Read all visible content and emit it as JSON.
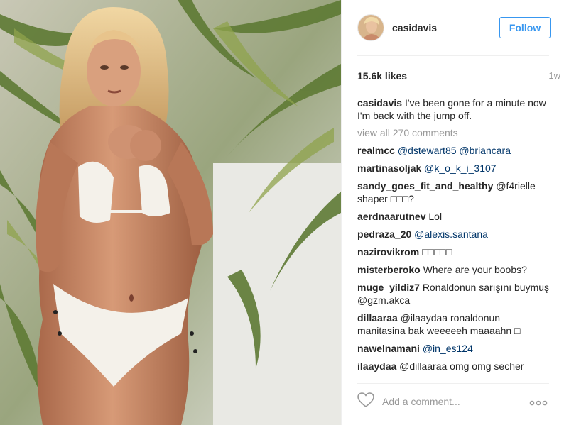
{
  "post": {
    "image_alt": "Woman in white crochet bikini in front of palm leaves"
  },
  "header": {
    "username": "casidavis",
    "follow_label": "Follow"
  },
  "stats": {
    "likes": "15.6k likes",
    "age": "1w"
  },
  "caption": {
    "username": "casidavis",
    "text": " I've been gone for a minute now I'm back with the jump off."
  },
  "view_all_label": "view all 270 comments",
  "comments": [
    {
      "user": "realmcc",
      "text": "@dstewart85 @briancara"
    },
    {
      "user": "martinasoljak",
      "text": "@k_o_k_i_3107"
    },
    {
      "user": "sandy_goes_fit_and_healthy",
      "text": "@f4rielle shaper □□□?"
    },
    {
      "user": "aerdnaarutnev",
      "text": "Lol"
    },
    {
      "user": "pedraza_20",
      "text": "@alexis.santana"
    },
    {
      "user": "nazirovikrom",
      "text": "□□□□□"
    },
    {
      "user": "misterberoko",
      "text": "Where are your boobs?"
    },
    {
      "user": "muge_yildiz7",
      "text": "Ronaldonun sarışını buymuş @gzm.akca"
    },
    {
      "user": "dillaaraa",
      "text": "@ilaaydaa ronaldonun manitasina bak weeeeeh maaaahn □"
    },
    {
      "user": "nawelnamani",
      "text": "@in_es124"
    },
    {
      "user": "ilaaydaa",
      "text": "@dillaaraa omg omg secher"
    }
  ],
  "footer": {
    "add_comment_placeholder": "Add a comment...",
    "like_icon": "heart-outline-icon",
    "more_icon": "ellipsis-icon"
  },
  "colors": {
    "link": "#3897f0",
    "mention": "#003569",
    "muted": "#999999",
    "text": "#262626"
  }
}
